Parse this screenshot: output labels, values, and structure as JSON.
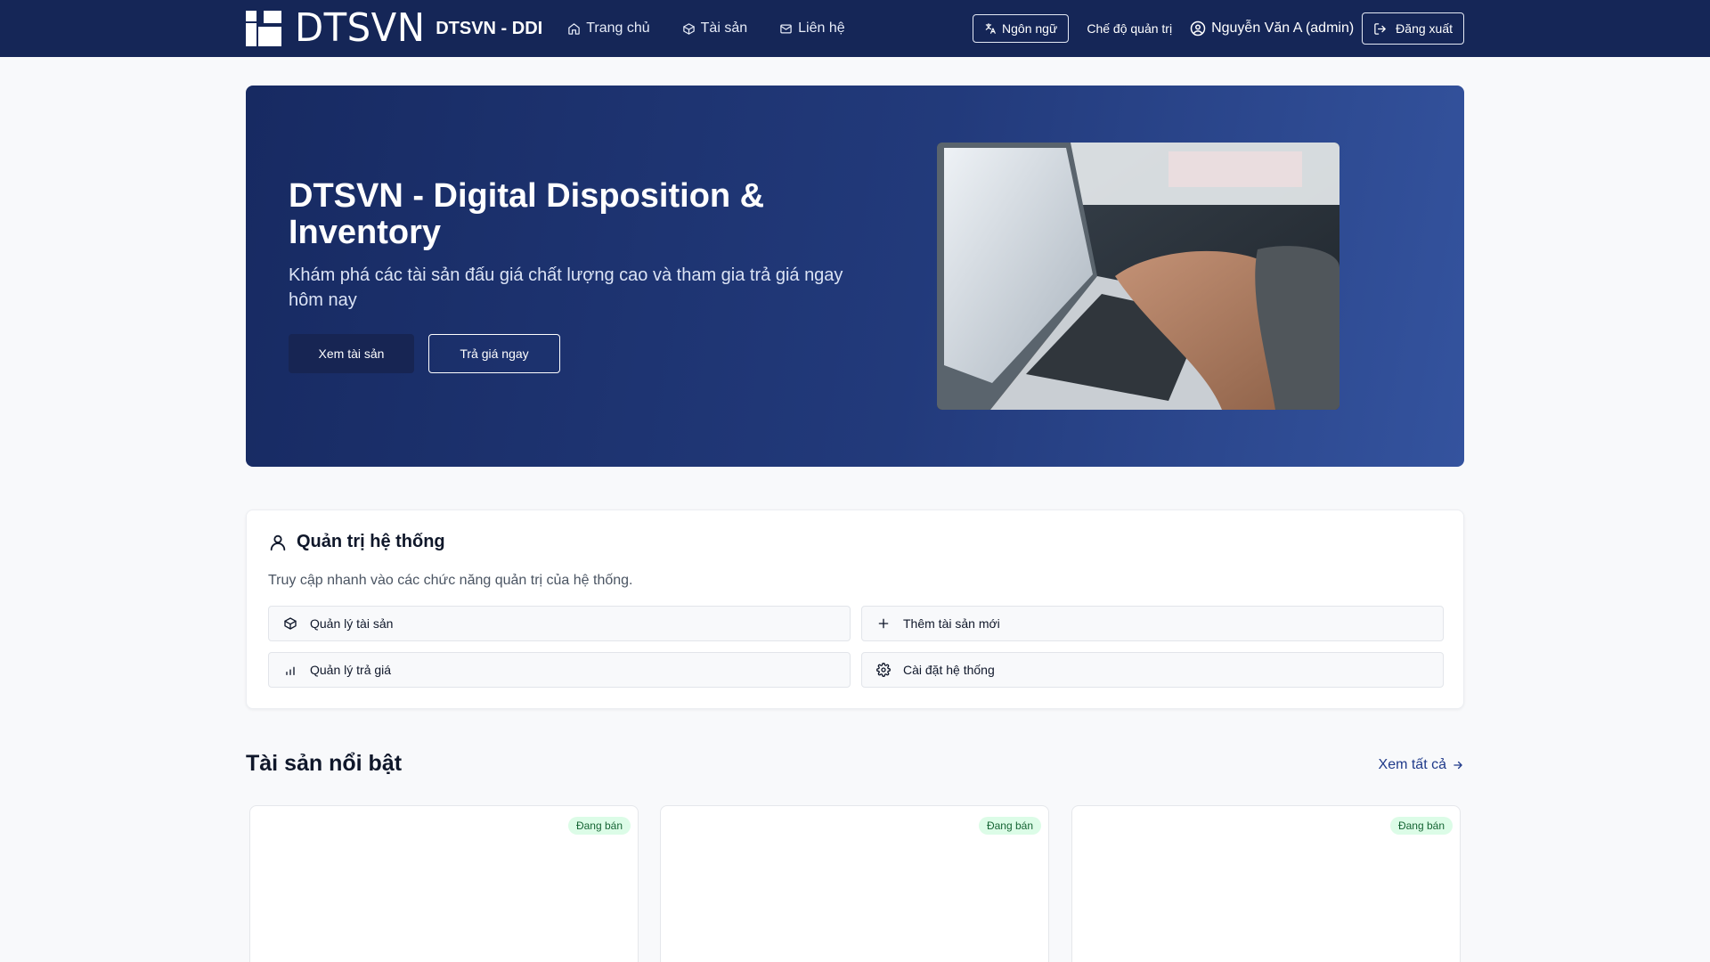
{
  "nav": {
    "logo_text": "DTSVN",
    "brand": "DTSVN - DDI",
    "links": [
      {
        "label": "Trang chủ",
        "icon": "home-icon"
      },
      {
        "label": "Tài sản",
        "icon": "box-icon"
      },
      {
        "label": "Liên hệ",
        "icon": "mail-icon"
      }
    ],
    "language_label": "Ngôn ngữ",
    "admin_mode_label": "Chế độ quản trị",
    "user_name": "Nguyễn Văn A (admin)",
    "logout_label": "Đăng xuất"
  },
  "hero": {
    "title": "DTSVN - Digital Disposition & Inventory",
    "subtitle": "Khám phá các tài sản đấu giá chất lượng cao và tham gia trả giá ngay hôm nay",
    "primary_button": "Xem tài sản",
    "secondary_button": "Trả giá ngay"
  },
  "admin": {
    "title": "Quản trị hệ thống",
    "description": "Truy cập nhanh vào các chức năng quản trị của hệ thống.",
    "actions": [
      {
        "label": "Quản lý tài sản",
        "icon": "box-icon"
      },
      {
        "label": "Thêm tài sản mới",
        "icon": "plus-icon"
      },
      {
        "label": "Quản lý trả giá",
        "icon": "bar-chart-icon"
      },
      {
        "label": "Cài đặt hệ thống",
        "icon": "gear-icon"
      }
    ]
  },
  "featured": {
    "title": "Tài sản nổi bật",
    "see_all": "Xem tất cả",
    "cards": [
      {
        "status": "Đang bán"
      },
      {
        "status": "Đang bán"
      },
      {
        "status": "Đang bán"
      }
    ]
  },
  "colors": {
    "navbar": "#152657",
    "hero_start": "#172a62",
    "hero_end": "#34539e",
    "badge_bg": "#dcfce7",
    "badge_text": "#166534",
    "link": "#1f3a8a"
  }
}
